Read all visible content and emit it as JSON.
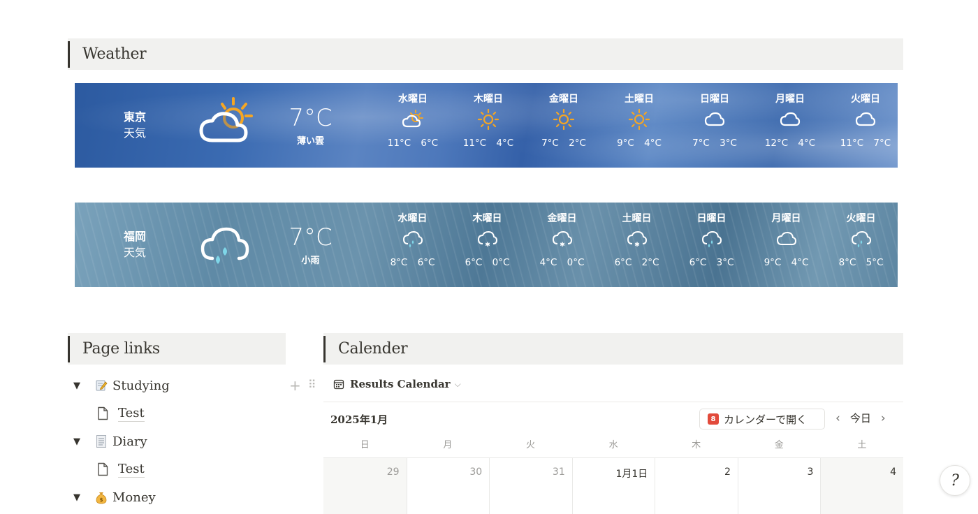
{
  "headings": {
    "weather": "Weather",
    "page_links": "Page links",
    "calendar": "Calender"
  },
  "weather": [
    {
      "city": "東京",
      "sub": "天気",
      "temp": "7°C",
      "desc": "薄い雲",
      "icon": "sun-cloud-icon",
      "days": [
        {
          "name": "水曜日",
          "icon": "sun-cloud-icon",
          "temps": "11°C 6°C"
        },
        {
          "name": "木曜日",
          "icon": "sun-icon",
          "temps": "11°C 4°C"
        },
        {
          "name": "金曜日",
          "icon": "sun-icon",
          "temps": "7°C 2°C"
        },
        {
          "name": "土曜日",
          "icon": "sun-icon",
          "temps": "9°C 4°C"
        },
        {
          "name": "日曜日",
          "icon": "cloud-icon",
          "temps": "7°C 3°C"
        },
        {
          "name": "月曜日",
          "icon": "cloud-icon",
          "temps": "12°C 4°C"
        },
        {
          "name": "火曜日",
          "icon": "cloud-icon",
          "temps": "11°C 7°C"
        }
      ]
    },
    {
      "city": "福岡",
      "sub": "天気",
      "temp": "7°C",
      "desc": "小雨",
      "icon": "rain-cloud-icon",
      "days": [
        {
          "name": "水曜日",
          "icon": "rain-cloud-icon",
          "temps": "8°C 6°C"
        },
        {
          "name": "木曜日",
          "icon": "snow-cloud-icon",
          "temps": "6°C 0°C"
        },
        {
          "name": "金曜日",
          "icon": "snow-cloud-icon",
          "temps": "4°C 0°C"
        },
        {
          "name": "土曜日",
          "icon": "snow-cloud-icon",
          "temps": "6°C 2°C"
        },
        {
          "name": "日曜日",
          "icon": "rain-cloud-icon",
          "temps": "6°C 3°C"
        },
        {
          "name": "月曜日",
          "icon": "cloud-icon",
          "temps": "9°C 4°C"
        },
        {
          "name": "火曜日",
          "icon": "rain-cloud-icon",
          "temps": "8°C 5°C"
        }
      ]
    }
  ],
  "page_links": [
    {
      "label": "Studying",
      "icon": "memo-icon",
      "toggle": "▼",
      "level": 0
    },
    {
      "label": "Test",
      "icon": "page-icon",
      "level": 1
    },
    {
      "label": "Diary",
      "icon": "document-icon",
      "toggle": "▼",
      "level": 0
    },
    {
      "label": "Test",
      "icon": "page-icon",
      "level": 1
    },
    {
      "label": "Money",
      "icon": "money-bag-icon",
      "toggle": "▼",
      "level": 0
    }
  ],
  "calendar": {
    "view_name": "Results Calendar",
    "month": "2025年1月",
    "open_button": "カレンダーで開く",
    "open_icon_day": "8",
    "today": "今日",
    "weekdays": [
      "日",
      "月",
      "火",
      "水",
      "木",
      "金",
      "土"
    ],
    "dates": [
      "29",
      "30",
      "31",
      "1月1日",
      "2",
      "3",
      "4"
    ]
  },
  "help": "?"
}
